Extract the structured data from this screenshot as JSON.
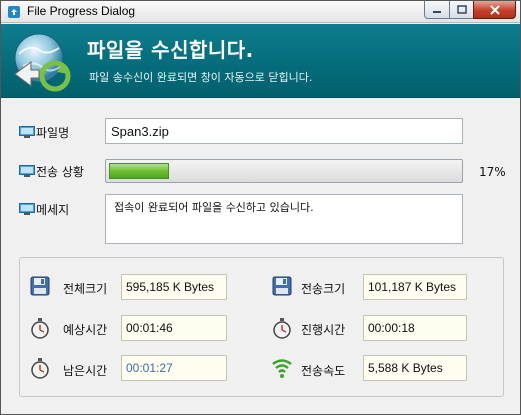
{
  "window": {
    "title": "File Progress Dialog"
  },
  "header": {
    "title": "파일을 수신합니다.",
    "subtitle": "파일 송수신이 완료되면 창이 자동으로 닫힙니다."
  },
  "form": {
    "filename_label": "파일명",
    "filename_value": "Span3.zip",
    "status_label": "전송 상황",
    "progress_percent": 17,
    "progress_text": "17%",
    "message_label": "메세지",
    "message_text": "접속이 완료되어 파일을 수신하고 있습니다."
  },
  "stats": {
    "total_size_label": "전체크기",
    "total_size_value": "595,185 K Bytes",
    "sent_size_label": "전송크기",
    "sent_size_value": "101,187 K Bytes",
    "estimated_time_label": "예상시간",
    "estimated_time_value": "00:01:46",
    "elapsed_time_label": "진행시간",
    "elapsed_time_value": "00:00:18",
    "remaining_time_label": "남은시간",
    "remaining_time_value": "00:01:27",
    "speed_label": "전송속도",
    "speed_value": "5,588 K Bytes"
  },
  "colors": {
    "header_bg": "#046b7a",
    "progress_green": "#6fbf35",
    "remaining_time_text": "#3b6ea8"
  },
  "icons": [
    "app-icon",
    "globe-transfer-icon",
    "monitor-icon",
    "disk-icon",
    "stopwatch-icon",
    "signal-icon"
  ]
}
